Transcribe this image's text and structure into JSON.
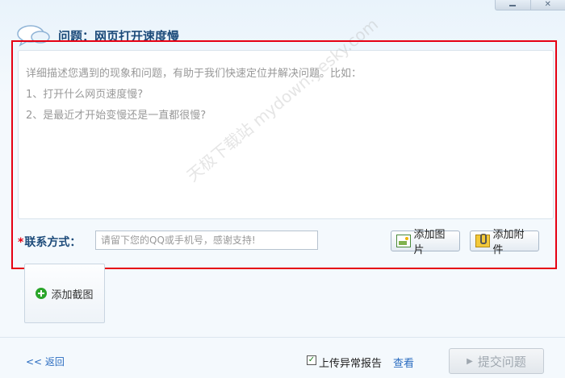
{
  "window": {
    "close_glyph": "✕"
  },
  "header": {
    "title": "问题：网页打开速度慢",
    "icon": "chat-bubbles-icon"
  },
  "description": {
    "lines": [
      "详细描述您遇到的现象和问题，有助于我们快速定位并解决问题。比如：",
      "1、打开什么网页速度慢?",
      "2、是最近才开始变慢还是一直都很慢?"
    ]
  },
  "watermark": {
    "text": "天极下载站 mydown.yesky.com"
  },
  "contact": {
    "star": "*",
    "label": "联系方式：",
    "placeholder": "请留下您的QQ或手机号，感谢支持!"
  },
  "buttons": {
    "add_image": "添加图片",
    "add_attachment": "添加附件",
    "add_screenshot": "添加截图"
  },
  "footer": {
    "back": "<< 返回",
    "upload_report": "上传异常报告",
    "upload_checked": true,
    "view": "查看",
    "submit": "提交问题"
  },
  "colors": {
    "highlight_border": "#e60012",
    "link": "#2a6cc0",
    "title": "#1d4b7a"
  }
}
